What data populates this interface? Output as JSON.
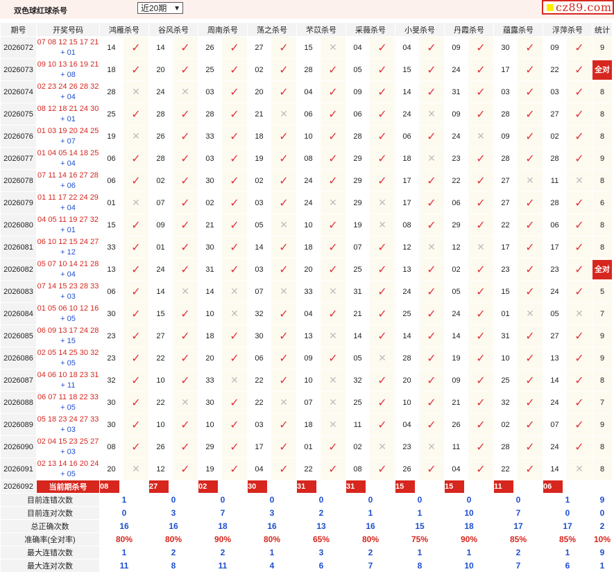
{
  "header": {
    "title": "双色球红球杀号",
    "period_select": "近20期",
    "logo": "cz89.com"
  },
  "columns": {
    "period": "期号",
    "draw": "开奖号码",
    "experts": [
      "鸿雁杀号",
      "谷风杀号",
      "周南杀号",
      "荡之杀号",
      "芣苡杀号",
      "采薇杀号",
      "小旻杀号",
      "丹霞杀号",
      "蕴露杀号",
      "浮萍杀号"
    ],
    "stats": "统计"
  },
  "rows": [
    {
      "period": "2026072",
      "red": "07 08 12 15 17 21",
      "blue": "+ 01",
      "kills": [
        [
          "14",
          1
        ],
        [
          "14",
          1
        ],
        [
          "26",
          1
        ],
        [
          "27",
          1
        ],
        [
          "15",
          0
        ],
        [
          "04",
          1
        ],
        [
          "04",
          1
        ],
        [
          "09",
          1
        ],
        [
          "30",
          1
        ],
        [
          "09",
          1
        ]
      ],
      "stat": "9"
    },
    {
      "period": "2026073",
      "red": "09 10 13 16 19 21",
      "blue": "+ 08",
      "kills": [
        [
          "18",
          1
        ],
        [
          "20",
          1
        ],
        [
          "25",
          1
        ],
        [
          "02",
          1
        ],
        [
          "28",
          1
        ],
        [
          "05",
          1
        ],
        [
          "15",
          1
        ],
        [
          "24",
          1
        ],
        [
          "17",
          1
        ],
        [
          "22",
          1
        ]
      ],
      "stat": "全对"
    },
    {
      "period": "2026074",
      "red": "02 23 24 26 28 32",
      "blue": "+ 04",
      "kills": [
        [
          "28",
          0
        ],
        [
          "24",
          0
        ],
        [
          "03",
          1
        ],
        [
          "20",
          1
        ],
        [
          "04",
          1
        ],
        [
          "09",
          1
        ],
        [
          "14",
          1
        ],
        [
          "31",
          1
        ],
        [
          "03",
          1
        ],
        [
          "03",
          1
        ]
      ],
      "stat": "8"
    },
    {
      "period": "2026075",
      "red": "08 12 18 21 24 30",
      "blue": "+ 01",
      "kills": [
        [
          "25",
          1
        ],
        [
          "28",
          1
        ],
        [
          "28",
          1
        ],
        [
          "21",
          0
        ],
        [
          "06",
          1
        ],
        [
          "06",
          1
        ],
        [
          "24",
          0
        ],
        [
          "09",
          1
        ],
        [
          "28",
          1
        ],
        [
          "27",
          1
        ]
      ],
      "stat": "8"
    },
    {
      "period": "2026076",
      "red": "01 03 19 20 24 25",
      "blue": "+ 07",
      "kills": [
        [
          "19",
          0
        ],
        [
          "26",
          1
        ],
        [
          "33",
          1
        ],
        [
          "18",
          1
        ],
        [
          "10",
          1
        ],
        [
          "28",
          1
        ],
        [
          "06",
          1
        ],
        [
          "24",
          0
        ],
        [
          "09",
          1
        ],
        [
          "02",
          1
        ]
      ],
      "stat": "8"
    },
    {
      "period": "2026077",
      "red": "01 04 05 14 18 25",
      "blue": "+ 04",
      "kills": [
        [
          "06",
          1
        ],
        [
          "28",
          1
        ],
        [
          "03",
          1
        ],
        [
          "19",
          1
        ],
        [
          "08",
          1
        ],
        [
          "29",
          1
        ],
        [
          "18",
          0
        ],
        [
          "23",
          1
        ],
        [
          "28",
          1
        ],
        [
          "28",
          1
        ]
      ],
      "stat": "9"
    },
    {
      "period": "2026078",
      "red": "07 11 14 16 27 28",
      "blue": "+ 06",
      "kills": [
        [
          "06",
          1
        ],
        [
          "02",
          1
        ],
        [
          "30",
          1
        ],
        [
          "02",
          1
        ],
        [
          "24",
          1
        ],
        [
          "29",
          1
        ],
        [
          "17",
          1
        ],
        [
          "22",
          1
        ],
        [
          "27",
          0
        ],
        [
          "11",
          0
        ]
      ],
      "stat": "8"
    },
    {
      "period": "2026079",
      "red": "01 11 17 22 24 29",
      "blue": "+ 04",
      "kills": [
        [
          "01",
          0
        ],
        [
          "07",
          1
        ],
        [
          "02",
          1
        ],
        [
          "03",
          1
        ],
        [
          "24",
          0
        ],
        [
          "29",
          0
        ],
        [
          "17",
          1
        ],
        [
          "06",
          1
        ],
        [
          "27",
          1
        ],
        [
          "28",
          1
        ]
      ],
      "stat": "6"
    },
    {
      "period": "2026080",
      "red": "04 05 11 19 27 32",
      "blue": "+ 01",
      "kills": [
        [
          "15",
          1
        ],
        [
          "09",
          1
        ],
        [
          "21",
          1
        ],
        [
          "05",
          0
        ],
        [
          "10",
          1
        ],
        [
          "19",
          0
        ],
        [
          "08",
          1
        ],
        [
          "29",
          1
        ],
        [
          "22",
          1
        ],
        [
          "06",
          1
        ]
      ],
      "stat": "8"
    },
    {
      "period": "2026081",
      "red": "06 10 12 15 24 27",
      "blue": "+ 12",
      "kills": [
        [
          "33",
          1
        ],
        [
          "01",
          1
        ],
        [
          "30",
          1
        ],
        [
          "14",
          1
        ],
        [
          "18",
          1
        ],
        [
          "07",
          1
        ],
        [
          "12",
          0
        ],
        [
          "12",
          0
        ],
        [
          "17",
          1
        ],
        [
          "17",
          1
        ]
      ],
      "stat": "8"
    },
    {
      "period": "2026082",
      "red": "05 07 10 14 21 28",
      "blue": "+ 04",
      "kills": [
        [
          "13",
          1
        ],
        [
          "24",
          1
        ],
        [
          "31",
          1
        ],
        [
          "03",
          1
        ],
        [
          "20",
          1
        ],
        [
          "25",
          1
        ],
        [
          "13",
          1
        ],
        [
          "02",
          1
        ],
        [
          "23",
          1
        ],
        [
          "23",
          1
        ]
      ],
      "stat": "全对"
    },
    {
      "period": "2026083",
      "red": "07 14 15 23 28 33",
      "blue": "+ 03",
      "kills": [
        [
          "06",
          1
        ],
        [
          "14",
          0
        ],
        [
          "14",
          0
        ],
        [
          "07",
          0
        ],
        [
          "33",
          0
        ],
        [
          "31",
          1
        ],
        [
          "24",
          1
        ],
        [
          "05",
          1
        ],
        [
          "15",
          1
        ],
        [
          "24",
          1
        ]
      ],
      "stat": "5"
    },
    {
      "period": "2026084",
      "red": "01 05 06 10 12 16",
      "blue": "+ 05",
      "kills": [
        [
          "30",
          1
        ],
        [
          "15",
          1
        ],
        [
          "10",
          0
        ],
        [
          "32",
          1
        ],
        [
          "04",
          1
        ],
        [
          "21",
          1
        ],
        [
          "25",
          1
        ],
        [
          "24",
          1
        ],
        [
          "01",
          0
        ],
        [
          "05",
          0
        ]
      ],
      "stat": "7"
    },
    {
      "period": "2026085",
      "red": "06 09 13 17 24 28",
      "blue": "+ 15",
      "kills": [
        [
          "23",
          1
        ],
        [
          "27",
          1
        ],
        [
          "18",
          1
        ],
        [
          "30",
          1
        ],
        [
          "13",
          0
        ],
        [
          "14",
          1
        ],
        [
          "14",
          1
        ],
        [
          "14",
          1
        ],
        [
          "31",
          1
        ],
        [
          "27",
          1
        ]
      ],
      "stat": "9"
    },
    {
      "period": "2026086",
      "red": "02 05 14 25 30 32",
      "blue": "+ 05",
      "kills": [
        [
          "23",
          1
        ],
        [
          "22",
          1
        ],
        [
          "20",
          1
        ],
        [
          "06",
          1
        ],
        [
          "09",
          1
        ],
        [
          "05",
          0
        ],
        [
          "28",
          1
        ],
        [
          "19",
          1
        ],
        [
          "10",
          1
        ],
        [
          "13",
          1
        ]
      ],
      "stat": "9"
    },
    {
      "period": "2026087",
      "red": "04 06 10 18 23 31",
      "blue": "+ 11",
      "kills": [
        [
          "32",
          1
        ],
        [
          "10",
          1
        ],
        [
          "33",
          0
        ],
        [
          "22",
          1
        ],
        [
          "10",
          0
        ],
        [
          "32",
          1
        ],
        [
          "20",
          1
        ],
        [
          "09",
          1
        ],
        [
          "25",
          1
        ],
        [
          "14",
          1
        ]
      ],
      "stat": "8"
    },
    {
      "period": "2026088",
      "red": "06 07 11 18 22 33",
      "blue": "+ 05",
      "kills": [
        [
          "30",
          1
        ],
        [
          "22",
          0
        ],
        [
          "30",
          1
        ],
        [
          "22",
          0
        ],
        [
          "07",
          0
        ],
        [
          "25",
          1
        ],
        [
          "10",
          1
        ],
        [
          "21",
          1
        ],
        [
          "32",
          1
        ],
        [
          "24",
          1
        ]
      ],
      "stat": "7"
    },
    {
      "period": "2026089",
      "red": "05 18 23 24 27 33",
      "blue": "+ 03",
      "kills": [
        [
          "30",
          1
        ],
        [
          "10",
          1
        ],
        [
          "10",
          1
        ],
        [
          "03",
          1
        ],
        [
          "18",
          0
        ],
        [
          "11",
          1
        ],
        [
          "04",
          1
        ],
        [
          "26",
          1
        ],
        [
          "02",
          1
        ],
        [
          "07",
          1
        ]
      ],
      "stat": "9"
    },
    {
      "period": "2026090",
      "red": "02 04 15 23 25 27",
      "blue": "+ 03",
      "kills": [
        [
          "08",
          1
        ],
        [
          "26",
          1
        ],
        [
          "29",
          1
        ],
        [
          "17",
          1
        ],
        [
          "01",
          1
        ],
        [
          "02",
          0
        ],
        [
          "23",
          0
        ],
        [
          "11",
          1
        ],
        [
          "28",
          1
        ],
        [
          "24",
          1
        ]
      ],
      "stat": "8"
    },
    {
      "period": "2026091",
      "red": "02 13 14 16 20 24",
      "blue": "+ 05",
      "kills": [
        [
          "20",
          0
        ],
        [
          "12",
          1
        ],
        [
          "19",
          1
        ],
        [
          "04",
          1
        ],
        [
          "22",
          1
        ],
        [
          "08",
          1
        ],
        [
          "26",
          1
        ],
        [
          "04",
          1
        ],
        [
          "22",
          1
        ],
        [
          "14",
          0
        ]
      ],
      "stat": "8"
    }
  ],
  "current": {
    "period": "2026092",
    "label": "当前期杀号",
    "kills": [
      "08",
      "27",
      "02",
      "30",
      "31",
      "31",
      "15",
      "15",
      "11",
      "06"
    ]
  },
  "stats": [
    {
      "label": "目前连错次数",
      "values": [
        "1",
        "0",
        "0",
        "0",
        "0",
        "0",
        "0",
        "0",
        "0",
        "1"
      ],
      "total": "9",
      "color": "blue"
    },
    {
      "label": "目前连对次数",
      "values": [
        "0",
        "3",
        "7",
        "3",
        "2",
        "1",
        "1",
        "10",
        "7",
        "0"
      ],
      "total": "0",
      "color": "blue"
    },
    {
      "label": "总正确次数",
      "values": [
        "16",
        "16",
        "18",
        "16",
        "13",
        "16",
        "15",
        "18",
        "17",
        "17"
      ],
      "total": "2",
      "color": "blue"
    },
    {
      "label": "准确率(全对率)",
      "values": [
        "80%",
        "80%",
        "90%",
        "80%",
        "65%",
        "80%",
        "75%",
        "90%",
        "85%",
        "85%"
      ],
      "total": "10%",
      "color": "red"
    },
    {
      "label": "最大连错次数",
      "values": [
        "1",
        "2",
        "2",
        "1",
        "3",
        "2",
        "1",
        "1",
        "2",
        "1"
      ],
      "total": "9",
      "color": "blue"
    },
    {
      "label": "最大连对次数",
      "values": [
        "11",
        "8",
        "11",
        "4",
        "6",
        "7",
        "8",
        "10",
        "7",
        "6"
      ],
      "total": "1",
      "color": "blue"
    }
  ],
  "icons": {
    "correct": "check-icon",
    "wrong": "cross-icon"
  },
  "colors": {
    "accent": "#d7261e",
    "correct": "#e2323d",
    "wrong": "#bdbdbd",
    "stat_blue": "#1e4fd0"
  }
}
